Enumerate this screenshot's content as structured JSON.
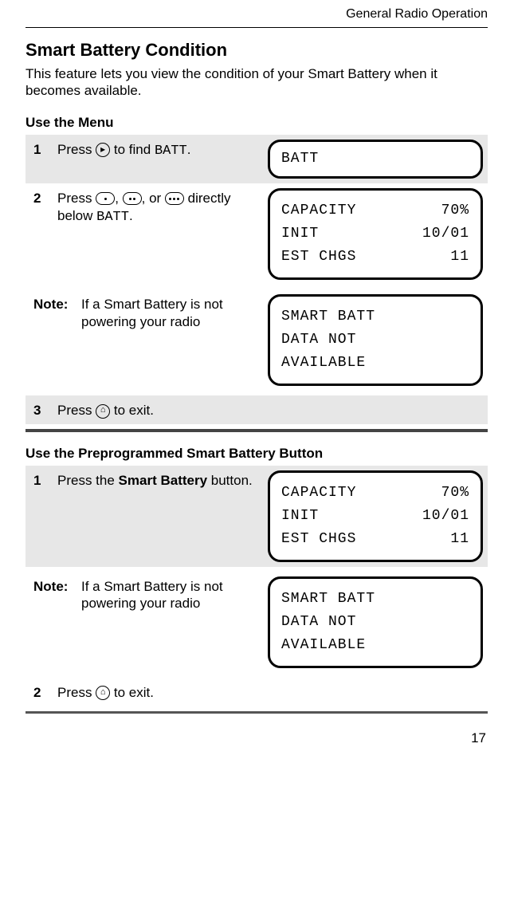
{
  "header": {
    "title": "General Radio Operation"
  },
  "section_title": "Smart Battery Condition",
  "intro": "This feature lets you view the condition of your Smart Battery when it becomes available.",
  "sub1_title": "Use the Menu",
  "sub1": {
    "s1": {
      "num": "1",
      "text_a": "Press ",
      "text_b": " to find ",
      "batt": "BATT",
      "text_c": "."
    },
    "s2": {
      "num": "2",
      "text_a": "Press ",
      "text_b": ", ",
      "text_c": ", or ",
      "text_d": " directly below ",
      "batt": "BATT",
      "text_e": "."
    },
    "note": {
      "label": "Note:",
      "text": "If a Smart Battery is not powering your radio"
    },
    "s3": {
      "num": "3",
      "text_a": "Press ",
      "text_b": " to exit."
    }
  },
  "screen_batt": {
    "line1": "BATT"
  },
  "screen_cap": {
    "l1a": "CAPACITY",
    "l1b": "70%",
    "l2a": "INIT",
    "l2b": "10/01",
    "l3a": "EST CHGS",
    "l3b": "11"
  },
  "screen_na": {
    "l1": "SMART BATT",
    "l2": "DATA NOT",
    "l3": "AVAILABLE"
  },
  "sub2_title": "Use the Preprogrammed Smart Battery Button",
  "sub2": {
    "s1": {
      "num": "1",
      "text_a": "Press the ",
      "bold": "Smart Battery",
      "text_b": " button."
    },
    "note": {
      "label": "Note:",
      "text": "If a Smart Battery is not powering your radio"
    },
    "s2": {
      "num": "2",
      "text_a": "Press ",
      "text_b": " to exit."
    }
  },
  "page_number": "17"
}
